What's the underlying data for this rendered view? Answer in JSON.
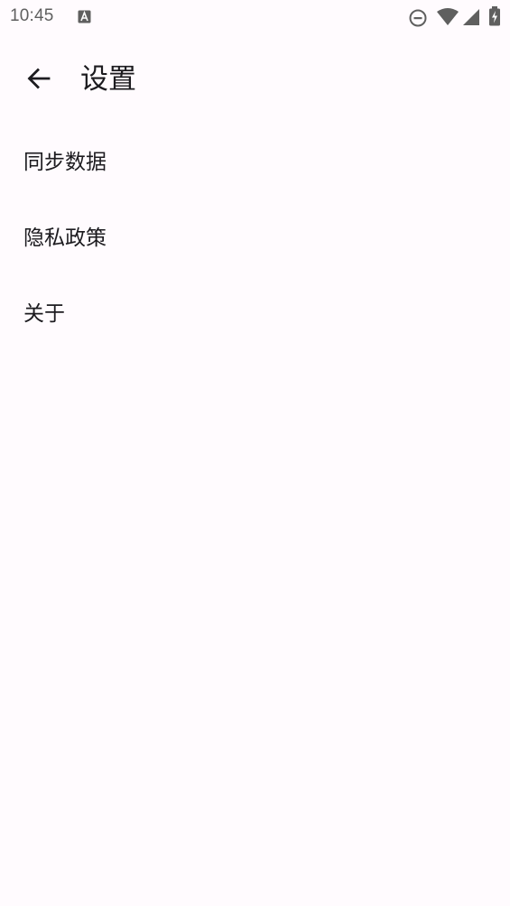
{
  "status_bar": {
    "time": "10:45",
    "notification_icon": "a-icon",
    "icons": [
      "do-not-disturb-icon",
      "wifi-icon",
      "signal-icon",
      "battery-charging-icon"
    ],
    "icon_color": "#5f5f5f"
  },
  "app_bar": {
    "back_icon": "arrow-back-icon",
    "title": "设置"
  },
  "menu": {
    "items": [
      {
        "label": "同步数据"
      },
      {
        "label": "隐私政策"
      },
      {
        "label": "关于"
      }
    ]
  },
  "colors": {
    "background": "#fffbfe",
    "text": "#1c1b1f"
  }
}
